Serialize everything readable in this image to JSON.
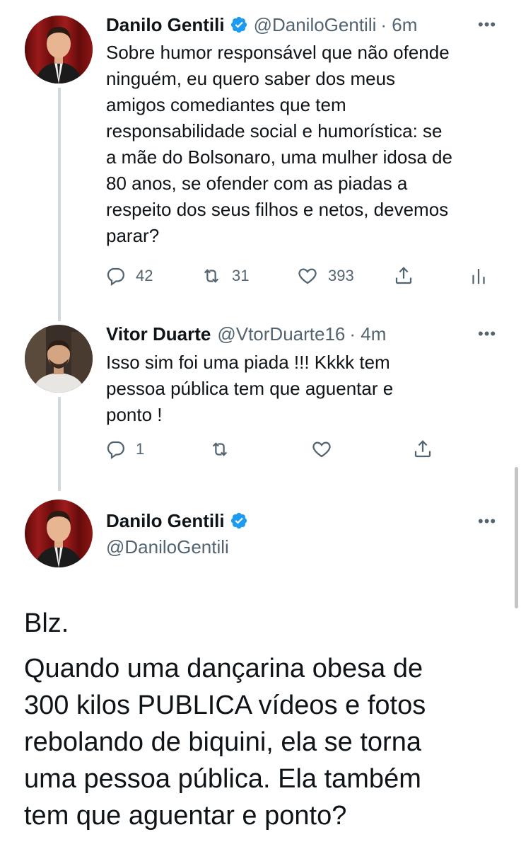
{
  "tweet1": {
    "name": "Danilo Gentili",
    "handle": "@DaniloGentili",
    "time": "· 6m",
    "lines": [
      "Sobre humor responsável que não ofende",
      "ninguém, eu quero saber dos meus",
      "amigos comediantes que tem",
      "responsabilidade social e humorística: se",
      "a mãe do Bolsonaro, uma mulher idosa de",
      "80 anos, se ofender com as piadas a",
      "respeito dos seus filhos e netos, devemos",
      "parar?"
    ],
    "replies": "42",
    "retweets": "31",
    "likes": "393",
    "icons": [
      "reply-icon",
      "retweet-icon",
      "like-icon",
      "share-icon",
      "analytics-icon"
    ]
  },
  "tweet2": {
    "name": "Vitor Duarte",
    "handle": "@VtorDuarte16",
    "time": "· 4m",
    "lines": [
      "Isso sim foi uma piada !!! Kkkk tem",
      "pessoa pública tem que aguentar e",
      "ponto !"
    ],
    "replies": "1"
  },
  "tweet3": {
    "name": "Danilo Gentili",
    "handle": "@DaniloGentili",
    "paragraph1": "Blz.",
    "lines": [
      "Quando uma dançarina obesa de",
      "300 kilos PUBLICA vídeos e fotos",
      "rebolando de biquini, ela se torna",
      "uma pessoa pública. Ela também",
      "tem que aguentar e ponto?"
    ]
  },
  "colors": {
    "verified": "#1d9bf0",
    "secondary_text": "#536471",
    "thread_line": "#cfd9de"
  }
}
